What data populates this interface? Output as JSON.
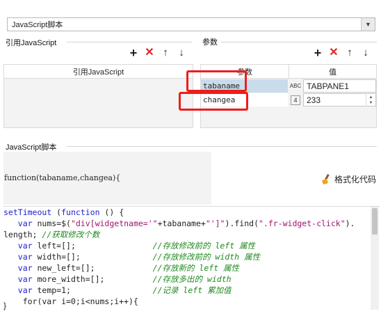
{
  "dropdown": {
    "value": "JavaScript脚本"
  },
  "ref_js": {
    "section_label": "引用JavaScript",
    "column_header": "引用JavaScript"
  },
  "params": {
    "section_label": "参数",
    "col_name": "参数",
    "col_value": "值",
    "rows": [
      {
        "name": "tabaname",
        "type_icon": "ABC",
        "value": "TABPANE1"
      },
      {
        "name": "changea",
        "type_icon": "4",
        "value": "233"
      }
    ]
  },
  "script": {
    "section_label": "JavaScript脚本",
    "signature": "function(tabaname,changea){",
    "format_button": "格式化代码",
    "closing": "}"
  },
  "colors": {
    "accent_red": "#e02424",
    "highlight_border": "#ef1c1c",
    "keyword": "#1b1bd0",
    "comment": "#1f8a1f"
  }
}
